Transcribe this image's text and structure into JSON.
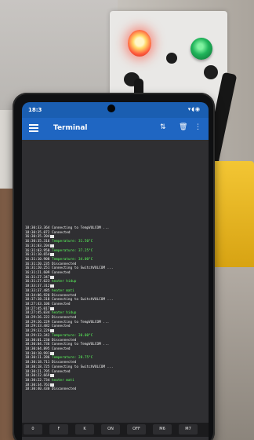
{
  "status_bar": {
    "time": "18:3"
  },
  "app": {
    "title": "Terminal"
  },
  "terminal_lines": [
    {
      "ts": "18:30:33.364",
      "msg": "Connecting to TempVULCOM ...",
      "type": "white",
      "mark": false
    },
    {
      "ts": "18:30:35.072",
      "msg": "Connected",
      "type": "white",
      "mark": false
    },
    {
      "ts": "16:30:35.204",
      "msg": "",
      "type": "white",
      "mark": true
    },
    {
      "ts": "16:30:35.316",
      "msg": "Temperature: 31.50°C",
      "type": "green",
      "mark": false
    },
    {
      "ts": "16:31:03.204",
      "msg": "",
      "type": "white",
      "mark": true
    },
    {
      "ts": "16:31:03.950",
      "msg": "Temperature: 37.25°C",
      "type": "green",
      "mark": false
    },
    {
      "ts": "16:31:10.654",
      "msg": "",
      "type": "white",
      "mark": true
    },
    {
      "ts": "16:31:10.908",
      "msg": "Temperature: 34.00°C",
      "type": "green",
      "mark": false
    },
    {
      "ts": "16:31:20.235",
      "msg": "Disconnected",
      "type": "white",
      "mark": false
    },
    {
      "ts": "16:31:20.251",
      "msg": "Connecting to SwitchVULCOM ...",
      "type": "white",
      "mark": false
    },
    {
      "ts": "16:31:21.609",
      "msg": "Connected",
      "type": "white",
      "mark": false
    },
    {
      "ts": "16:31:27.347",
      "msg": "",
      "type": "white",
      "mark": true
    },
    {
      "ts": "16:31:27.623",
      "msg": "heater hidup",
      "type": "green",
      "mark": false
    },
    {
      "ts": "18:33:37.312",
      "msg": "",
      "type": "white",
      "mark": true
    },
    {
      "ts": "18:33:37.485",
      "msg": "heater mati",
      "type": "green",
      "mark": false
    },
    {
      "ts": "18:34:06.920",
      "msg": "Disconnected",
      "type": "white",
      "mark": false
    },
    {
      "ts": "18:37:38.318",
      "msg": "Connecting to SwitchVULCOM ...",
      "type": "white",
      "mark": false
    },
    {
      "ts": "18:27:43.106",
      "msg": "Connected",
      "type": "white",
      "mark": false
    },
    {
      "ts": "18:27:45.017",
      "msg": "",
      "type": "white",
      "mark": true
    },
    {
      "ts": "18:27:45.034",
      "msg": "heater hidup",
      "type": "green",
      "mark": false
    },
    {
      "ts": "18:29:26.222",
      "msg": "Disconnected",
      "type": "white",
      "mark": false
    },
    {
      "ts": "18:29:26.229",
      "msg": "Connecting to TempVULCOM ...",
      "type": "white",
      "mark": false
    },
    {
      "ts": "18:29:33.482",
      "msg": "Connected",
      "type": "white",
      "mark": false
    },
    {
      "ts": "18:29:33.229",
      "msg": "",
      "type": "white",
      "mark": true
    },
    {
      "ts": "18:29:33.342",
      "msg": "Temperature: 30.00°C",
      "type": "green",
      "mark": false
    },
    {
      "ts": "18:30:01.230",
      "msg": "Disconnected",
      "type": "white",
      "mark": false
    },
    {
      "ts": "18:30:04.736",
      "msg": "Connecting to TempVULCOM ...",
      "type": "white",
      "mark": false
    },
    {
      "ts": "18:30:04.895",
      "msg": "Connected",
      "type": "white",
      "mark": false
    },
    {
      "ts": "18:30:10.991",
      "msg": "",
      "type": "white",
      "mark": true
    },
    {
      "ts": "18:30:11.286",
      "msg": "Temperature: 28.75°C",
      "type": "green",
      "mark": false
    },
    {
      "ts": "18:30:18.711",
      "msg": "Disconnected",
      "type": "white",
      "mark": false
    },
    {
      "ts": "18:30:18.725",
      "msg": "Connecting to SwitchVULCOM ...",
      "type": "white",
      "mark": false
    },
    {
      "ts": "18:30:21.795",
      "msg": "Connected",
      "type": "white",
      "mark": false
    },
    {
      "ts": "18:30:22.669",
      "msg": "",
      "type": "white",
      "mark": true
    },
    {
      "ts": "18:30:22.734",
      "msg": "heater mati",
      "type": "green",
      "mark": false
    },
    {
      "ts": "18:30:34.763",
      "msg": "",
      "type": "white",
      "mark": true
    },
    {
      "ts": "18:30:40.430",
      "msg": "Disconnected",
      "type": "white",
      "mark": false
    }
  ],
  "macro_buttons": [
    "0",
    "F",
    "K",
    "ON",
    "OFF",
    "M6",
    "M7"
  ],
  "colors": {
    "appbar": "#1f66c2",
    "terminal_bg": "#2f2f32",
    "green_text": "#5dff5d"
  }
}
